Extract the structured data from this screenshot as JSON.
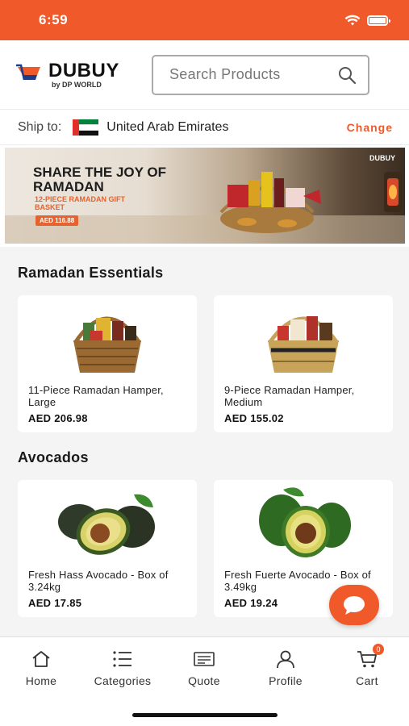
{
  "status_bar": {
    "time": "6:59"
  },
  "header": {
    "logo_main": "DUBUY",
    "logo_sub": "by DP WORLD",
    "search_placeholder": "Search Products"
  },
  "ship_to": {
    "label": "Ship to:",
    "country": "United Arab Emirates",
    "change_label": "Change"
  },
  "banner": {
    "headline": "SHARE THE JOY OF RAMADAN",
    "subline": "12-PIECE RAMADAN GIFT BASKET",
    "price": "AED 116.88",
    "brand": "DUBUY"
  },
  "sections": [
    {
      "title": "Ramadan Essentials",
      "products": [
        {
          "name": "11-Piece Ramadan Hamper, Large",
          "price": "AED 206.98"
        },
        {
          "name": "9-Piece Ramadan Hamper, Medium",
          "price": "AED 155.02"
        }
      ]
    },
    {
      "title": "Avocados",
      "products": [
        {
          "name": "Fresh Hass Avocado - Box of 3.24kg",
          "price": "AED 17.85"
        },
        {
          "name": "Fresh Fuerte Avocado - Box of 3.49kg",
          "price": "AED 19.24"
        }
      ]
    }
  ],
  "tabbar": {
    "home": "Home",
    "categories": "Categories",
    "quote": "Quote",
    "profile": "Profile",
    "cart": "Cart",
    "cart_count": "0"
  },
  "colors": {
    "accent": "#f05a2b",
    "flag_red": "#e0302a",
    "flag_green": "#00843d"
  }
}
